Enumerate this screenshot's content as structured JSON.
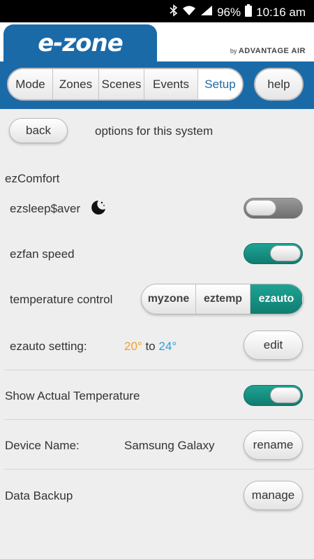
{
  "status_bar": {
    "battery": "96%",
    "time": "10:16 am",
    "icons": [
      "bluetooth-icon",
      "wifi-icon",
      "signal-icon",
      "battery-icon"
    ]
  },
  "header": {
    "logo": "e-zone",
    "brand_prefix": "by",
    "brand_name": "ADVANTAGE AIR"
  },
  "nav": {
    "tabs": [
      {
        "label": "Mode"
      },
      {
        "label": "Zones"
      },
      {
        "label": "Scenes"
      },
      {
        "label": "Events"
      },
      {
        "label": "Setup"
      }
    ],
    "active_tab": "Setup",
    "help_label": "help"
  },
  "page": {
    "back_label": "back",
    "subtitle": "options for this system",
    "section_title": "ezComfort"
  },
  "settings": {
    "ezsleep": {
      "label": "ezsleep$aver",
      "enabled": false
    },
    "ezfan": {
      "label": "ezfan speed",
      "enabled": true
    },
    "temperature_control": {
      "label": "temperature control",
      "options": [
        "myzone",
        "eztemp",
        "ezauto"
      ],
      "selected": "ezauto"
    },
    "ezauto_setting": {
      "label": "ezauto setting:",
      "low": "20°",
      "to": "to",
      "high": "24°",
      "edit_label": "edit"
    },
    "show_actual_temperature": {
      "label": "Show Actual Temperature",
      "enabled": true
    },
    "device_name": {
      "label": "Device Name:",
      "value": "Samsung Galaxy",
      "rename_label": "rename"
    },
    "data_backup": {
      "label": "Data Backup",
      "manage_label": "manage"
    }
  },
  "colors": {
    "brand_blue": "#1b6aa8",
    "toggle_on": "#148f81",
    "low_temp": "#f0a030",
    "high_temp": "#2aa0d8"
  }
}
